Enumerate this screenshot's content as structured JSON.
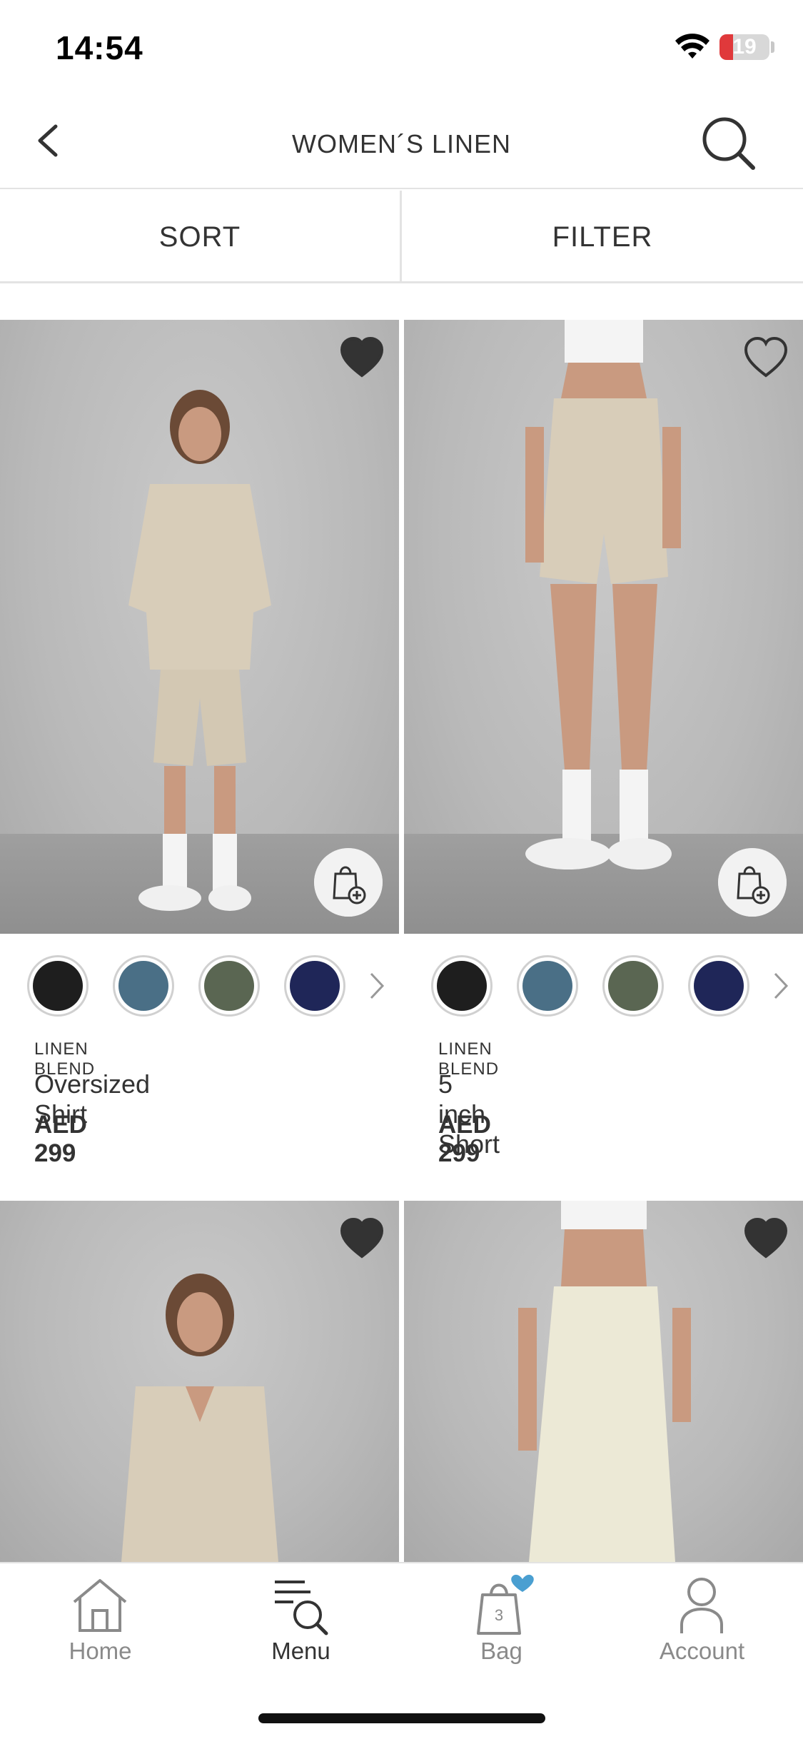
{
  "status_bar": {
    "time": "14:54",
    "battery_level": "19",
    "battery_fraction": 0.19
  },
  "header": {
    "title": "WOMEN´S LINEN"
  },
  "sortbar": {
    "sort_label": "SORT",
    "filter_label": "FILTER"
  },
  "products": [
    {
      "tag": "LINEN BLEND",
      "name": "Oversized Shirt",
      "price": "AED 299",
      "wishlisted": true,
      "swatches": [
        "#1e1e1e",
        "#4a6f86",
        "#5a6652",
        "#1f2658"
      ]
    },
    {
      "tag": "LINEN BLEND",
      "name": "5 inch Short",
      "price": "AED 299",
      "wishlisted": false,
      "swatches": [
        "#1e1e1e",
        "#4a6f86",
        "#5a6652",
        "#1f2658"
      ]
    },
    {
      "wishlisted": true
    },
    {
      "wishlisted": true
    }
  ],
  "tabbar": {
    "items": [
      {
        "label": "Home",
        "icon": "home-icon"
      },
      {
        "label": "Menu",
        "icon": "menu-search-icon",
        "active": true
      },
      {
        "label": "Bag",
        "icon": "bag-icon",
        "badge": "3"
      },
      {
        "label": "Account",
        "icon": "account-icon"
      }
    ]
  },
  "colors": {
    "accent": "#4a9fd1",
    "text": "#333333",
    "muted": "#8a8a8a",
    "battery_low": "#e0393b"
  }
}
